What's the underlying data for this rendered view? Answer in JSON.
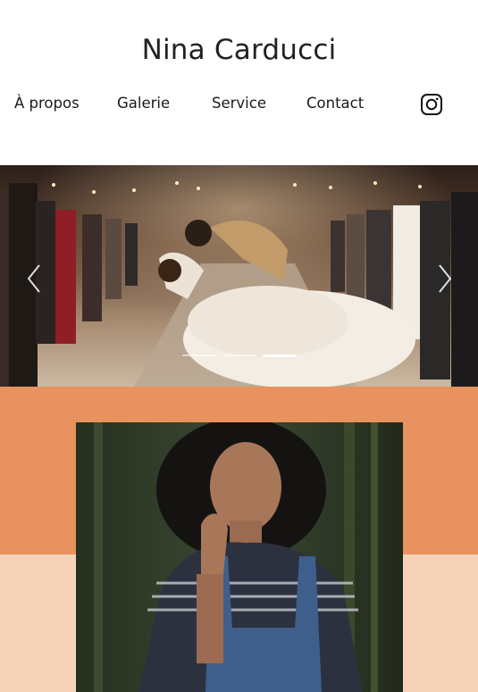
{
  "site": {
    "title": "Nina Carducci"
  },
  "nav": {
    "items": [
      {
        "label": "À propos"
      },
      {
        "label": "Galerie"
      },
      {
        "label": "Service"
      },
      {
        "label": "Contact"
      }
    ],
    "instagram_icon": "instagram-icon"
  },
  "hero": {
    "image": "wedding-couple-kiss-photo",
    "slides_total": 3,
    "active_slide": 3,
    "prev_icon": "chevron-left-icon",
    "next_icon": "chevron-right-icon"
  },
  "about": {
    "image": "woman-portrait-photo",
    "colors": {
      "band_top": "#e8935f",
      "band_bottom": "#f6d3b8"
    }
  }
}
